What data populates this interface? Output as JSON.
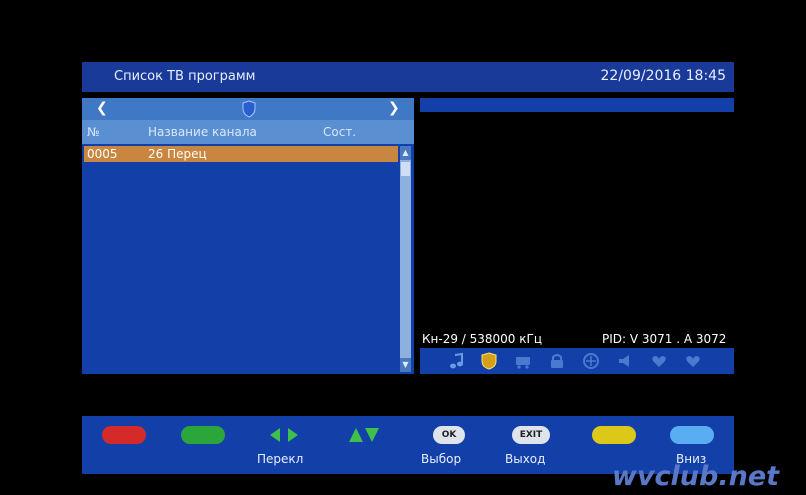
{
  "header": {
    "title": "Список ТВ программ",
    "datetime": "22/09/2016 18:45"
  },
  "channel_list": {
    "nav_left": "❮",
    "nav_right": "❯",
    "columns": {
      "number": "№",
      "name": "Название канала",
      "state": "Сост."
    },
    "rows": [
      {
        "number": "0005",
        "name": "26 Перец",
        "selected": true
      }
    ]
  },
  "info": {
    "frequency": "Кн-29 / 538000 кГц",
    "pid": "PID: V 3071 . A 3072"
  },
  "status_icons": [
    "music-note-icon",
    "shield-icon",
    "cart-icon",
    "lock-icon",
    "scramble-icon",
    "speaker-icon",
    "heart-icon",
    "heart-icon"
  ],
  "bottom_bar": {
    "ok_label": "OK",
    "exit_label": "EXIT",
    "perekl": "Перекл",
    "vybor": "Выбор",
    "vyhod": "Выход",
    "vniz": "Вниз"
  },
  "colors": {
    "panel": "#1340a8",
    "selected_row": "#c8863e",
    "red": "#d42a2a",
    "green": "#2aa63a",
    "yellow": "#dcc818",
    "blue": "#58aef0"
  },
  "watermark": "wvclub.net"
}
